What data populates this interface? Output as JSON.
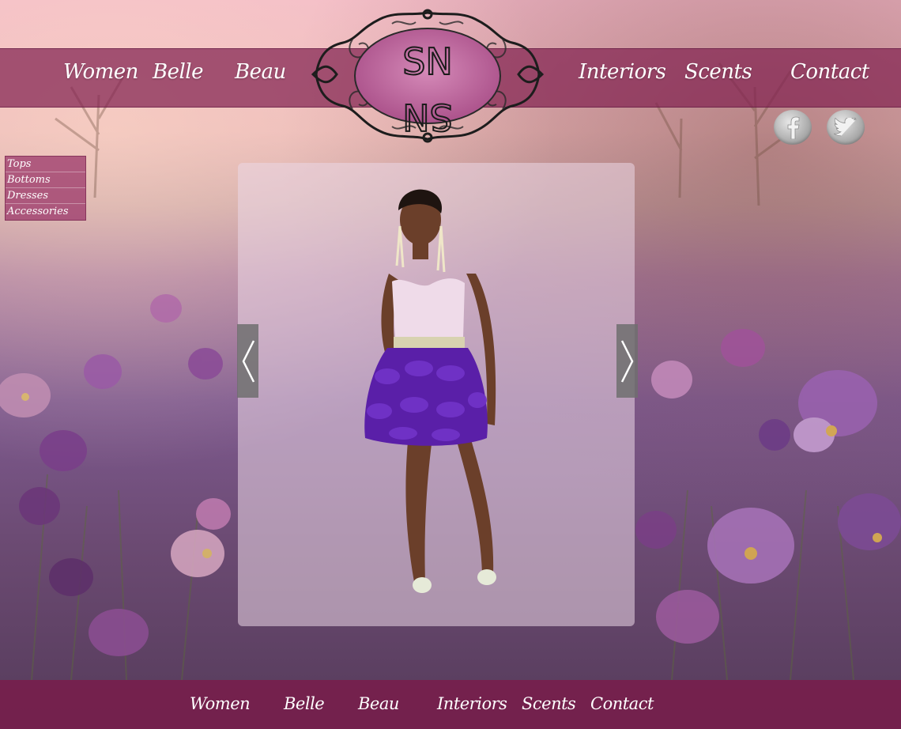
{
  "brand": {
    "logo_text": "SN"
  },
  "nav": {
    "left": [
      {
        "label": "Women"
      },
      {
        "label": "Belle"
      },
      {
        "label": "Beau"
      }
    ],
    "right": [
      {
        "label": "Interiors"
      },
      {
        "label": "Scents"
      },
      {
        "label": "Contact"
      }
    ]
  },
  "social": [
    {
      "name": "facebook-icon",
      "glyph": "f"
    },
    {
      "name": "twitter-icon",
      "glyph": "t"
    }
  ],
  "sidebar": {
    "items": [
      {
        "label": "Tops"
      },
      {
        "label": "Bottoms"
      },
      {
        "label": "Dresses"
      },
      {
        "label": "Accessories"
      }
    ]
  },
  "gallery": {
    "prev_glyph": "‹",
    "next_glyph": "›"
  },
  "footer": {
    "links": [
      {
        "label": "Women"
      },
      {
        "label": "Belle"
      },
      {
        "label": "Beau"
      },
      {
        "label": "Interiors"
      },
      {
        "label": "Scents"
      },
      {
        "label": "Contact"
      }
    ]
  },
  "colors": {
    "nav_bar": "#82234f",
    "footer_bar": "#781e4b",
    "dress_purple": "#5a1fa8",
    "panel": "#ebd7e6"
  }
}
